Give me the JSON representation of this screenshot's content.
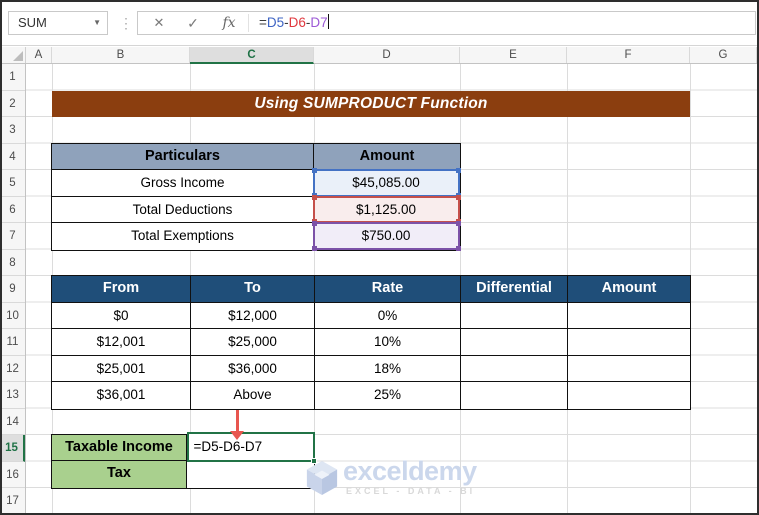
{
  "formula_bar": {
    "name_box_value": "SUM",
    "name_box_dropdown_icon": "▼",
    "separator_dots_icon": "⋮",
    "cancel_label": "✕",
    "enter_label": "✓",
    "insert_function_label": "fx",
    "formula_parts": [
      {
        "text": "=",
        "color": "#3b3b3b"
      },
      {
        "text": "D5",
        "color": "#3e64c4"
      },
      {
        "text": "-",
        "color": "#3b3b3b"
      },
      {
        "text": "D6",
        "color": "#e0383e"
      },
      {
        "text": "-",
        "color": "#3b3b3b"
      },
      {
        "text": "D7",
        "color": "#9c59d6"
      }
    ]
  },
  "grid": {
    "columns": [
      "A",
      "B",
      "C",
      "D",
      "E",
      "F",
      "G"
    ],
    "rows": [
      "1",
      "2",
      "3",
      "4",
      "5",
      "6",
      "7",
      "8",
      "9",
      "10",
      "11",
      "12",
      "13",
      "14",
      "15",
      "16",
      "17"
    ],
    "selected_column": "C",
    "selected_row": "15",
    "selection_color": "#217346"
  },
  "banner": {
    "title": "Using SUMPRODUCT Function",
    "bg_color": "#8b3e0f"
  },
  "table1": {
    "headers": [
      "Particulars",
      "Amount"
    ],
    "header_bg": "#8fa2bb",
    "rows": [
      {
        "particulars": "Gross Income",
        "amount": "$45,085.00",
        "ref": "D5",
        "border_color": "#4472c4",
        "fill_color": "#eaf0f9"
      },
      {
        "particulars": "Total Deductions",
        "amount": "$1,125.00",
        "ref": "D6",
        "border_color": "#c5504b",
        "fill_color": "#f9eded"
      },
      {
        "particulars": "Total Exemptions",
        "amount": "$750.00",
        "ref": "D7",
        "border_color": "#7c52a8",
        "fill_color": "#f1edf8"
      }
    ]
  },
  "table2": {
    "headers": [
      "From",
      "To",
      "Rate",
      "Differential",
      "Amount"
    ],
    "header_bg": "#1f4e79",
    "rows": [
      [
        "$0",
        "$12,000",
        "0%",
        "",
        ""
      ],
      [
        "$12,001",
        "$25,000",
        "10%",
        "",
        ""
      ],
      [
        "$25,001",
        "$36,000",
        "18%",
        "",
        ""
      ],
      [
        "$36,001",
        "Above",
        "25%",
        "",
        ""
      ]
    ]
  },
  "summary": {
    "taxable_income_label": "Taxable Income",
    "taxable_income_value": "=D5-D6-D7",
    "tax_label": "Tax",
    "tax_value": "",
    "label_bg": "#a9d08e"
  },
  "watermark": {
    "brand": "exceldemy",
    "tagline": "EXCEL - DATA - BI"
  }
}
